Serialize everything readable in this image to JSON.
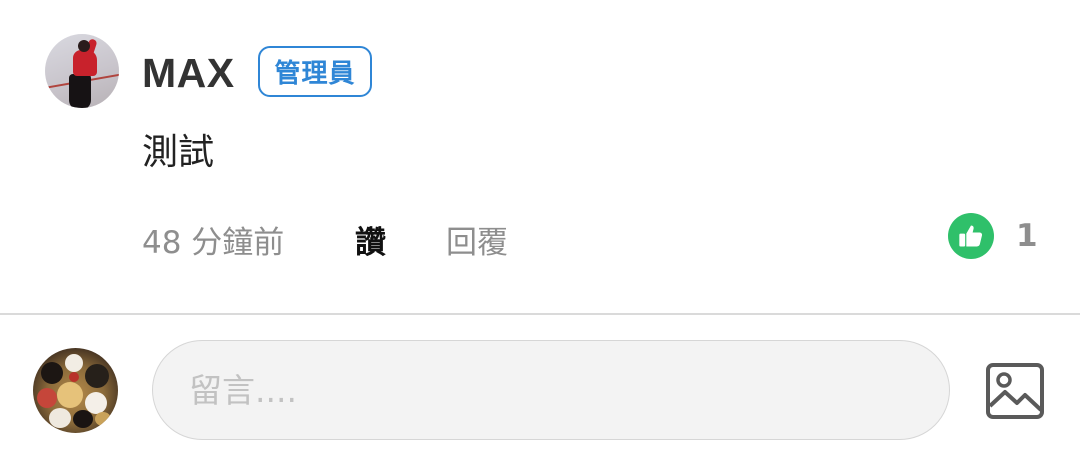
{
  "comment": {
    "author": "MAX",
    "badge": "管理員",
    "text": "測試",
    "time": "48 分鐘前",
    "like_label": "讚",
    "reply_label": "回覆",
    "like_count": "1",
    "like_icon": "thumbs-up-icon",
    "like_color": "#2fc06a",
    "badge_color": "#2f86d6"
  },
  "composer": {
    "placeholder": "留言....",
    "image_icon": "image-icon"
  }
}
